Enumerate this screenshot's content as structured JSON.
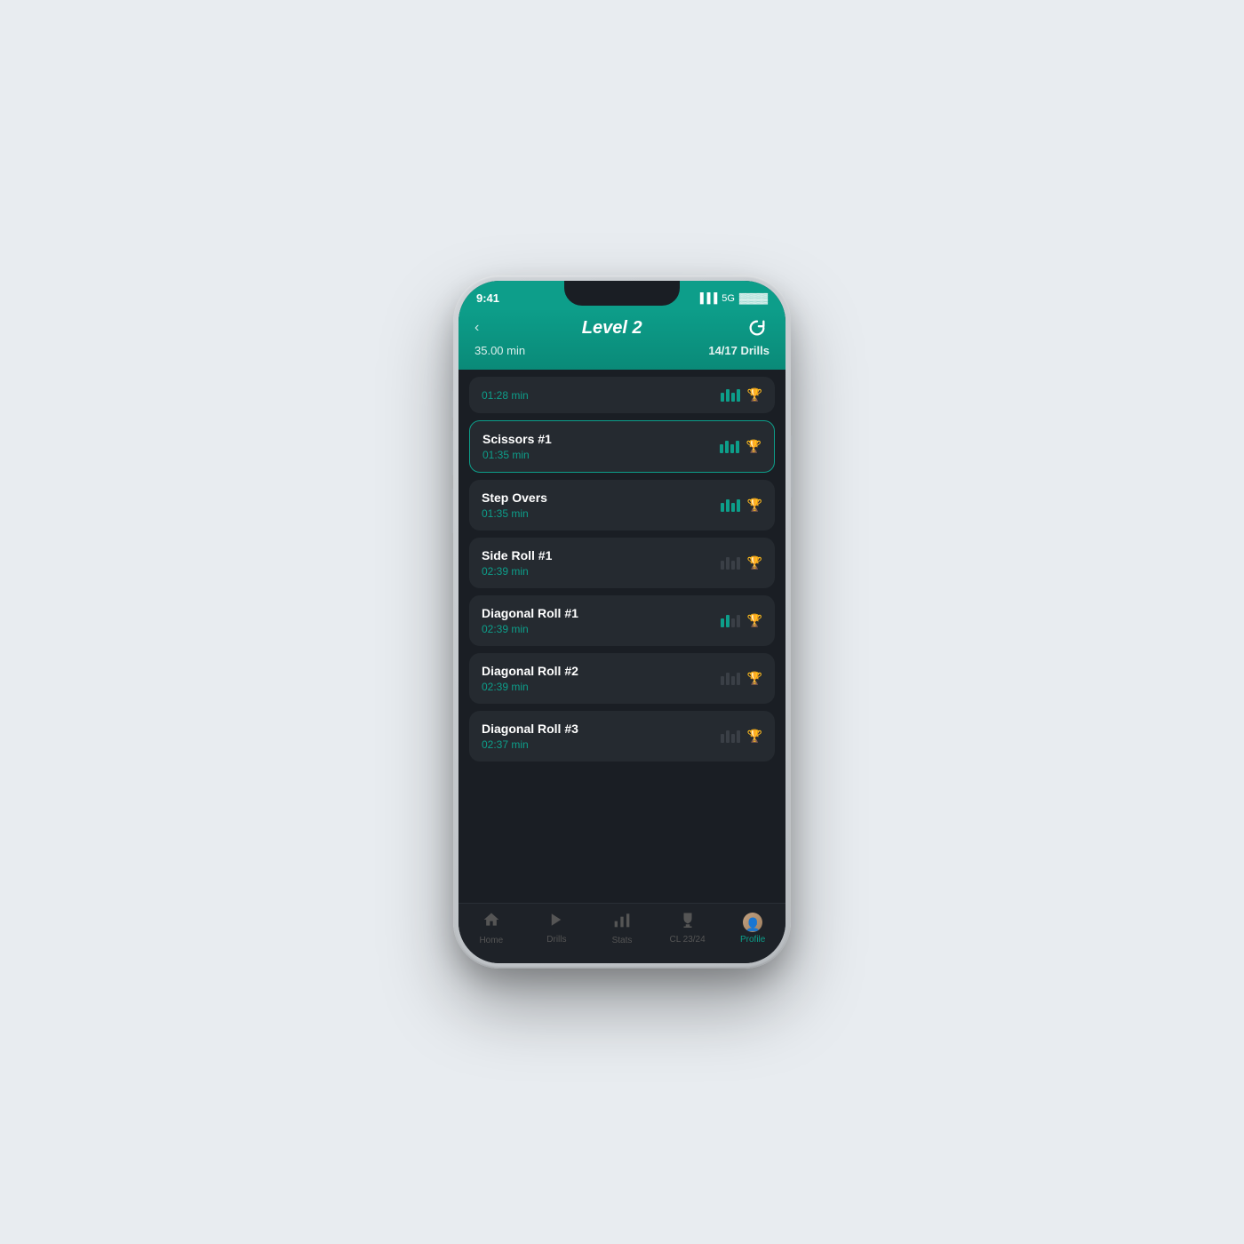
{
  "device": {
    "time": "9:41",
    "signal": "5G"
  },
  "header": {
    "back_label": "‹",
    "title": "Level 2",
    "duration": "35.00 min",
    "drills_count": "14/17 Drills",
    "refresh_icon": "↻"
  },
  "drills": [
    {
      "id": 0,
      "name": "",
      "time": "01:28 min",
      "partial": true,
      "active": false,
      "bars_filled": 4,
      "trophy_active": true
    },
    {
      "id": 1,
      "name": "Scissors #1",
      "time": "01:35 min",
      "partial": false,
      "active": true,
      "bars_filled": 4,
      "trophy_active": true
    },
    {
      "id": 2,
      "name": "Step Overs",
      "time": "01:35 min",
      "partial": false,
      "active": false,
      "bars_filled": 4,
      "trophy_active": false
    },
    {
      "id": 3,
      "name": "Side Roll #1",
      "time": "02:39 min",
      "partial": false,
      "active": false,
      "bars_filled": 0,
      "trophy_active": false
    },
    {
      "id": 4,
      "name": "Diagonal Roll #1",
      "time": "02:39 min",
      "partial": false,
      "active": false,
      "bars_filled": 2,
      "trophy_active": false
    },
    {
      "id": 5,
      "name": "Diagonal Roll #2",
      "time": "02:39 min",
      "partial": false,
      "active": false,
      "bars_filled": 0,
      "trophy_active": false
    },
    {
      "id": 6,
      "name": "Diagonal Roll #3",
      "time": "02:37 min",
      "partial": false,
      "active": false,
      "bars_filled": 0,
      "trophy_active": false
    }
  ],
  "nav": {
    "items": [
      {
        "id": "home",
        "label": "Home",
        "icon": "⌂",
        "active": false
      },
      {
        "id": "drills",
        "label": "Drills",
        "icon": "▶",
        "active": false
      },
      {
        "id": "stats",
        "label": "Stats",
        "icon": "📊",
        "active": false
      },
      {
        "id": "cl",
        "label": "CL 23/24",
        "icon": "🏆",
        "active": false
      },
      {
        "id": "profile",
        "label": "Profile",
        "icon": "👤",
        "active": true
      }
    ]
  }
}
